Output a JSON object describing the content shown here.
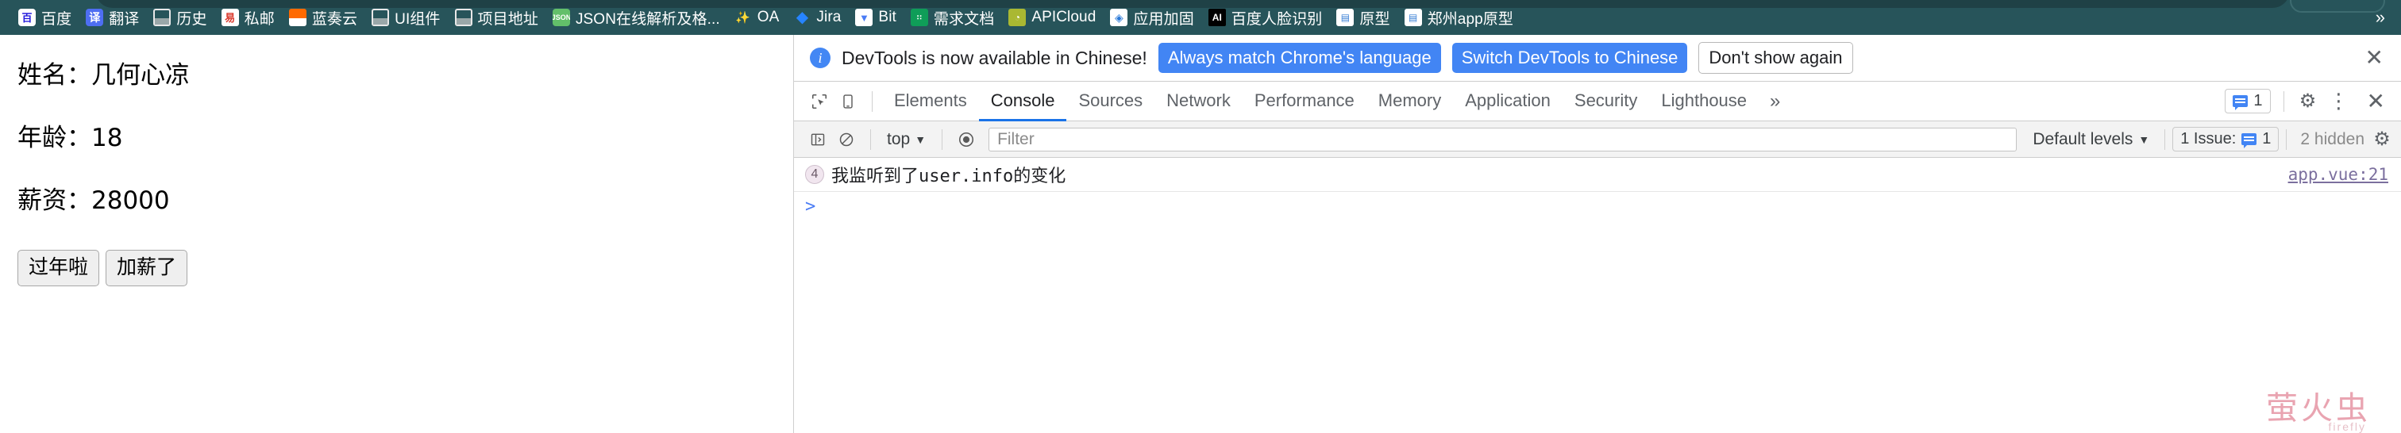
{
  "bookmarks": [
    {
      "label": "百度",
      "icon": "baidu-paw-icon",
      "fav": "fav-baidu",
      "glyph": "百"
    },
    {
      "label": "翻译",
      "icon": "translate-icon",
      "fav": "fav-fanyi",
      "glyph": "译"
    },
    {
      "label": "历史",
      "icon": "folder-icon",
      "fav": "fav-folder",
      "glyph": ""
    },
    {
      "label": "私邮",
      "icon": "netease-mail-icon",
      "fav": "fav-simail",
      "glyph": "易"
    },
    {
      "label": "蓝奏云",
      "icon": "lanzou-cloud-icon",
      "fav": "fav-lanzou",
      "glyph": ""
    },
    {
      "label": "UI组件",
      "icon": "folder-icon",
      "fav": "fav-folder",
      "glyph": ""
    },
    {
      "label": "项目地址",
      "icon": "folder-icon",
      "fav": "fav-folder",
      "glyph": ""
    },
    {
      "label": "JSON在线解析及格...",
      "icon": "json-icon",
      "fav": "fav-json",
      "glyph": "JSON"
    },
    {
      "label": "OA",
      "icon": "oa-icon",
      "fav": "fav-oa",
      "glyph": "✨"
    },
    {
      "label": "Jira",
      "icon": "jira-icon",
      "fav": "fav-jira",
      "glyph": "◆"
    },
    {
      "label": "Bit",
      "icon": "bit-icon",
      "fav": "fav-bit",
      "glyph": "▼"
    },
    {
      "label": "需求文档",
      "icon": "google-sheets-icon",
      "fav": "fav-doc",
      "glyph": "∷"
    },
    {
      "label": "APICloud",
      "icon": "apicloud-icon",
      "fav": "fav-api",
      "glyph": "◔"
    },
    {
      "label": "应用加固",
      "icon": "app-hardening-icon",
      "fav": "fav-jiagu",
      "glyph": "◈"
    },
    {
      "label": "百度人脸识别",
      "icon": "baidu-ai-icon",
      "fav": "fav-ai",
      "glyph": "AI"
    },
    {
      "label": "原型",
      "icon": "prototype-icon",
      "fav": "fav-proto",
      "glyph": "▤"
    },
    {
      "label": "郑州app原型",
      "icon": "prototype-icon",
      "fav": "fav-proto",
      "glyph": "▤"
    }
  ],
  "bookmark_overflow": "»",
  "page": {
    "name_line": "姓名：几何心凉",
    "age_line": "年龄：18",
    "salary_line": "薪资：28000",
    "button_new_year": "过年啦",
    "button_raise": "加薪了",
    "watermark": "萤火虫",
    "watermark_sub": "firefly"
  },
  "devtools": {
    "banner": {
      "text": "DevTools is now available in Chinese!",
      "primary_button": "Always match Chrome's language",
      "secondary_button": "Switch DevTools to Chinese",
      "dismiss_button": "Don't show again",
      "info_glyph": "i",
      "close_glyph": "✕"
    },
    "tabs": [
      {
        "label": "Elements",
        "active": false
      },
      {
        "label": "Console",
        "active": true
      },
      {
        "label": "Sources",
        "active": false
      },
      {
        "label": "Network",
        "active": false
      },
      {
        "label": "Performance",
        "active": false
      },
      {
        "label": "Memory",
        "active": false
      },
      {
        "label": "Application",
        "active": false
      },
      {
        "label": "Security",
        "active": false
      },
      {
        "label": "Lighthouse",
        "active": false
      }
    ],
    "tabs_overflow": "»",
    "tab_issue_count": "1",
    "settings_glyph": "⚙",
    "kebab_glyph": "⋮",
    "close_glyph": "✕",
    "toolbar": {
      "context": "top",
      "context_caret": "▼",
      "filter_placeholder": "Filter",
      "levels": "Default levels",
      "levels_caret": "▼",
      "issue_label": "1 Issue:",
      "issue_count": "1",
      "hidden": "2 hidden",
      "settings_glyph": "⚙",
      "clear_glyph": "⃠",
      "eye_glyph": "◉",
      "sidebar_glyph": "◨"
    },
    "console": {
      "log_count": "4",
      "log_message": "我监听到了user.info的变化",
      "log_source": "app.vue:21",
      "prompt": ">"
    }
  }
}
